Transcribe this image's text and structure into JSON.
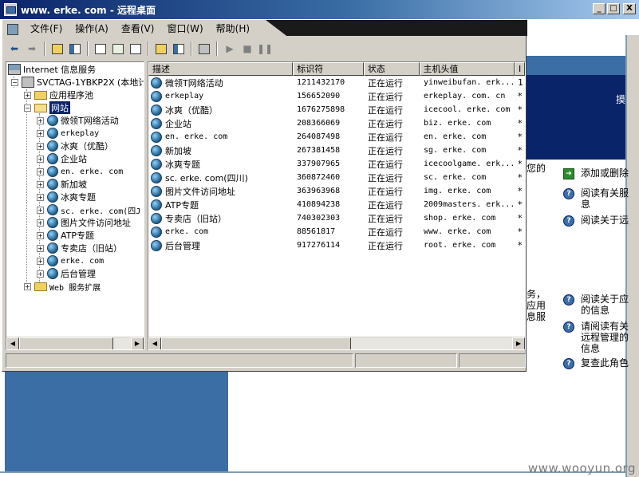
{
  "rdp": {
    "title": "www. erke. com - 远程桌面",
    "buttons": {
      "minimize": "_",
      "maximize": "□",
      "close": "X"
    }
  },
  "mmc": {
    "menu": [
      "文件(F)",
      "操作(A)",
      "查看(V)",
      "窗口(W)",
      "帮助(H)"
    ],
    "toolbar_icons": [
      "back-arrow-icon",
      "forward-arrow-icon",
      "up-folder-icon",
      "show-tree-icon",
      "properties-icon",
      "refresh-icon",
      "export-list-icon",
      "help-icon",
      "mmc-pane-icon",
      "computer-icon",
      "play-icon",
      "stop-icon",
      "pause-icon"
    ],
    "tree": {
      "root": "Internet 信息服务",
      "server": "SVCTAG-1YBKP2X (本地计",
      "app_pool": "应用程序池",
      "sites_folder": "网站",
      "sites": [
        "微领T网络活动",
        "erkeplay",
        "冰爽（优酷）",
        "企业站",
        "en. erke. com",
        "新加坡",
        "冰爽专题",
        "sc. erke. com(四J",
        "图片文件访问地址",
        "ATP专题",
        "专卖店（旧站）",
        "erke. com",
        "后台管理"
      ],
      "web_ext": "Web 服务扩展"
    },
    "columns": [
      "描述",
      "标识符",
      "状态",
      "主机头值",
      "I"
    ],
    "rows": [
      {
        "desc": "微领T网络活动",
        "id": "1211432170",
        "status": "正在运行",
        "host": "yinweibufan. erk...",
        "ip": "1"
      },
      {
        "desc": "erkeplay",
        "id": "156652090",
        "status": "正在运行",
        "host": "erkeplay. com. cn",
        "ip": "*"
      },
      {
        "desc": "冰爽（优酷）",
        "id": "1676275898",
        "status": "正在运行",
        "host": "icecool. erke. com",
        "ip": "*"
      },
      {
        "desc": "企业站",
        "id": "208366069",
        "status": "正在运行",
        "host": "biz. erke. com",
        "ip": "*"
      },
      {
        "desc": "en. erke. com",
        "id": "264087498",
        "status": "正在运行",
        "host": "en. erke. com",
        "ip": "*"
      },
      {
        "desc": "新加坡",
        "id": "267381458",
        "status": "正在运行",
        "host": "sg. erke. com",
        "ip": "*"
      },
      {
        "desc": "冰爽专题",
        "id": "337907965",
        "status": "正在运行",
        "host": "icecoolgame. erk...",
        "ip": "*"
      },
      {
        "desc": "sc. erke. com(四川)",
        "id": "360872460",
        "status": "正在运行",
        "host": "sc. erke. com",
        "ip": "*"
      },
      {
        "desc": "图片文件访问地址",
        "id": "363963968",
        "status": "正在运行",
        "host": "img. erke. com",
        "ip": "*"
      },
      {
        "desc": "ATP专题",
        "id": "410894238",
        "status": "正在运行",
        "host": "2009masters. erk...",
        "ip": "*"
      },
      {
        "desc": "专卖店（旧站）",
        "id": "740302303",
        "status": "正在运行",
        "host": "shop. erke. com",
        "ip": "*"
      },
      {
        "desc": "erke. com",
        "id": "88561817",
        "status": "正在运行",
        "host": "www. erke. com",
        "ip": "*"
      },
      {
        "desc": "后台管理",
        "id": "917276114",
        "status": "正在运行",
        "host": "root. erke. com",
        "ip": "*"
      }
    ]
  },
  "background": {
    "edge_char": "摸",
    "frag_top": "您的",
    "frag_mid": [
      "务，",
      "应用",
      "息服"
    ],
    "tasks_top": [
      {
        "icon": "add-icon",
        "label": "添加或删除"
      },
      {
        "icon": "help-icon",
        "label": "阅读有关服\n息"
      },
      {
        "icon": "help-icon",
        "label": "阅读关于远"
      }
    ],
    "tasks_bottom": [
      {
        "icon": "help-icon",
        "label": "阅读关于应\n的信息"
      },
      {
        "icon": "help-icon",
        "label": "请阅读有关\n远程管理的\n信息"
      },
      {
        "icon": "help-icon",
        "label": "复查此角色"
      }
    ],
    "watermark": "www.wooyun.org"
  }
}
